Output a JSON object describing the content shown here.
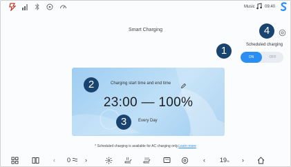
{
  "status_bar": {
    "icons": [
      "app-logo-icon",
      "signal-icon",
      "bluetooth-icon",
      "location-icon",
      "speedometer-icon"
    ],
    "music_label": "Music",
    "time": "09:40",
    "brand_icon": "s-logo-icon"
  },
  "page": {
    "title": "Smart Charging",
    "gear_icon": "settings-gear-icon"
  },
  "scheduled": {
    "label": "Scheduled charging",
    "on_label": "ON",
    "off_label": "OFF",
    "state": "ON"
  },
  "card": {
    "heading": "Charging start time and end time",
    "time_range": "23:00 — 100%",
    "repeat": "Every Day"
  },
  "badges": [
    "1",
    "2",
    "3",
    "4"
  ],
  "note": {
    "text": "* Scheduled charging is available for AC charging only.",
    "link": "Learn more"
  },
  "bottom_bar": {
    "left_temp": "0",
    "right_value": "19",
    "right_unit": "%",
    "icons": [
      "apps-grid-icon",
      "split-screen-icon",
      "chevron-left-icon",
      "defrost-rear-icon",
      "chevron-right-icon",
      "fan-icon",
      "seat-heat-icon",
      "seat-ventilation-icon",
      "rear-defrost-icon",
      "climate-icon",
      "chevron-left-icon",
      "chevron-right-icon",
      "home-icon"
    ]
  },
  "colors": {
    "accent": "#2a8ef5",
    "badge": "#1a4470",
    "card_start": "#9fcdf1",
    "card_end": "#9ccaf0",
    "brand": "#2a8ef5"
  }
}
